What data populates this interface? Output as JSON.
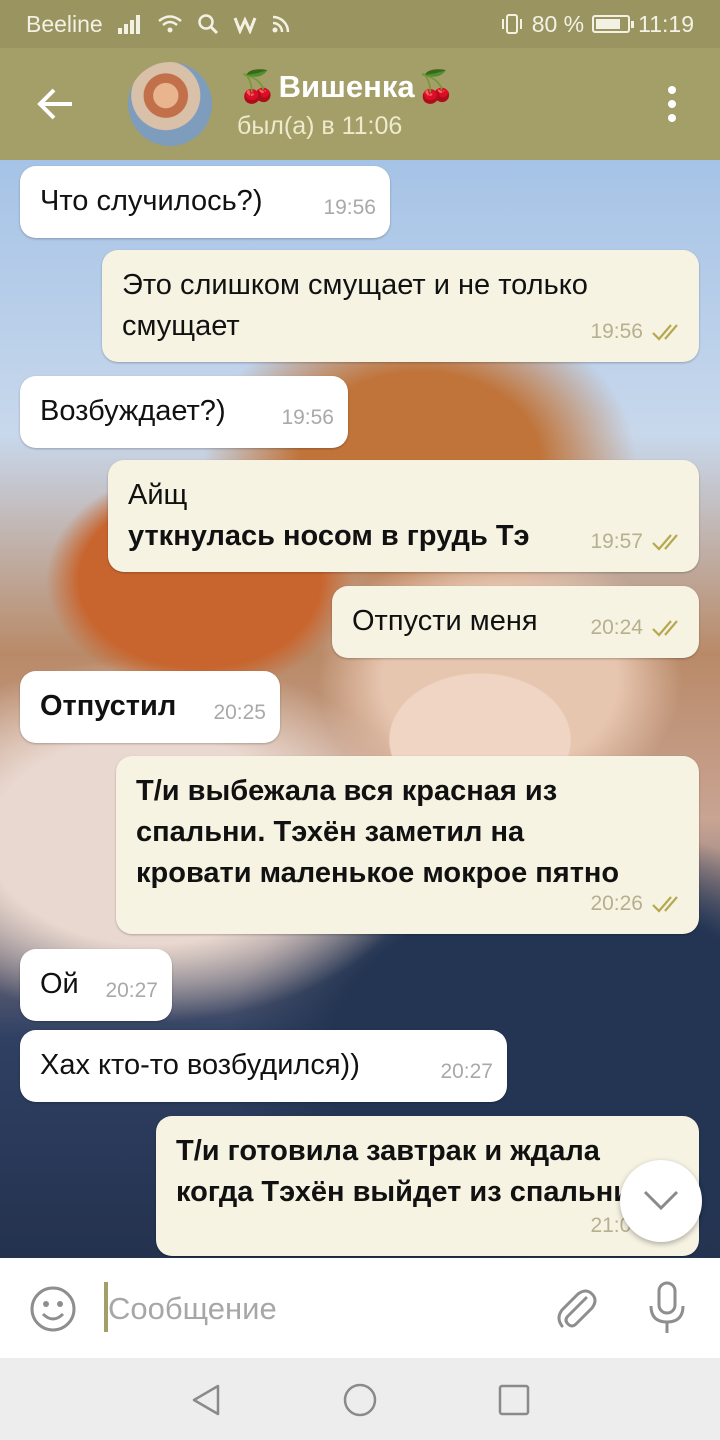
{
  "status_bar": {
    "carrier": "Beeline",
    "battery": "80 %",
    "battery_level": 0.8,
    "time": "11:19"
  },
  "header": {
    "title": "Вишенка",
    "subtitle": "был(а) в 11:06",
    "title_emoji": "🍒"
  },
  "messages": [
    {
      "dir": "in",
      "lines": [
        "Что случилось?)"
      ],
      "bold": false,
      "time": "19:56"
    },
    {
      "dir": "out",
      "lines": [
        "Это слишком смущает и не только",
        "смущает"
      ],
      "bold": false,
      "time": "19:56",
      "read": true
    },
    {
      "dir": "in",
      "lines": [
        "Возбуждает?)"
      ],
      "bold": false,
      "time": "19:56"
    },
    {
      "dir": "out",
      "lines": [
        "Айщ",
        "уткнулась носом в грудь Тэ"
      ],
      "bold_line": 1,
      "time": "19:57",
      "read": true
    },
    {
      "dir": "out",
      "lines": [
        "Отпусти меня"
      ],
      "bold": false,
      "time": "20:24",
      "read": true
    },
    {
      "dir": "in",
      "lines": [
        "Отпустил"
      ],
      "bold": true,
      "time": "20:25"
    },
    {
      "dir": "out",
      "lines": [
        "Т/и выбежала вся красная из",
        "спальни. Тэхён заметил на",
        "кровати маленькое мокрое пятно"
      ],
      "bold": true,
      "time": "20:26",
      "read": true
    },
    {
      "dir": "in",
      "lines": [
        "Ой"
      ],
      "bold": false,
      "time": "20:27"
    },
    {
      "dir": "in",
      "lines": [
        "Хах кто-то возбудился))"
      ],
      "bold": false,
      "time": "20:27"
    },
    {
      "dir": "out",
      "lines": [
        "Т/и готовила завтрак и ждала",
        "когда Тэхён выйдет из спальни"
      ],
      "bold": true,
      "time": "21:07",
      "read": true
    }
  ],
  "input": {
    "placeholder": "Сообщение"
  },
  "colors": {
    "header": "#a49f68",
    "statusbar": "#9a9460",
    "outgoing_bubble": "#f6f3e3",
    "incoming_bubble": "#ffffff",
    "ticks": "#b6a84e"
  }
}
